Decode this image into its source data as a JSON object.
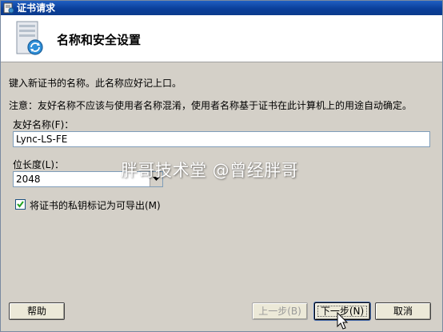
{
  "window": {
    "title": "证书请求"
  },
  "header": {
    "title": "名称和安全设置"
  },
  "body": {
    "intro": "键入新证书的名称。此名称应好记上口。",
    "note": "注意：友好名称不应该与使用者名称混淆，使用者名称基于证书在此计算机上的用途自动确定。",
    "friendly_name": {
      "label": "友好名称(F)：",
      "value": "Lync-LS-FE"
    },
    "bit_length": {
      "label": "位长度(L)：",
      "value": "2048"
    },
    "exportable": {
      "label": "将证书的私钥标记为可导出(M)",
      "checked": true
    }
  },
  "buttons": {
    "help": "帮助",
    "back": "上一步(B)",
    "next": "下一步(N)",
    "cancel": "取消"
  },
  "watermark": "胖哥技术堂 @曾经胖哥",
  "icons": {
    "title": "certificate-app-icon",
    "header": "certificate-server-icon",
    "combo": "chevron-down-icon",
    "check": "checkmark-icon",
    "cursor": "mouse-pointer-icon"
  }
}
